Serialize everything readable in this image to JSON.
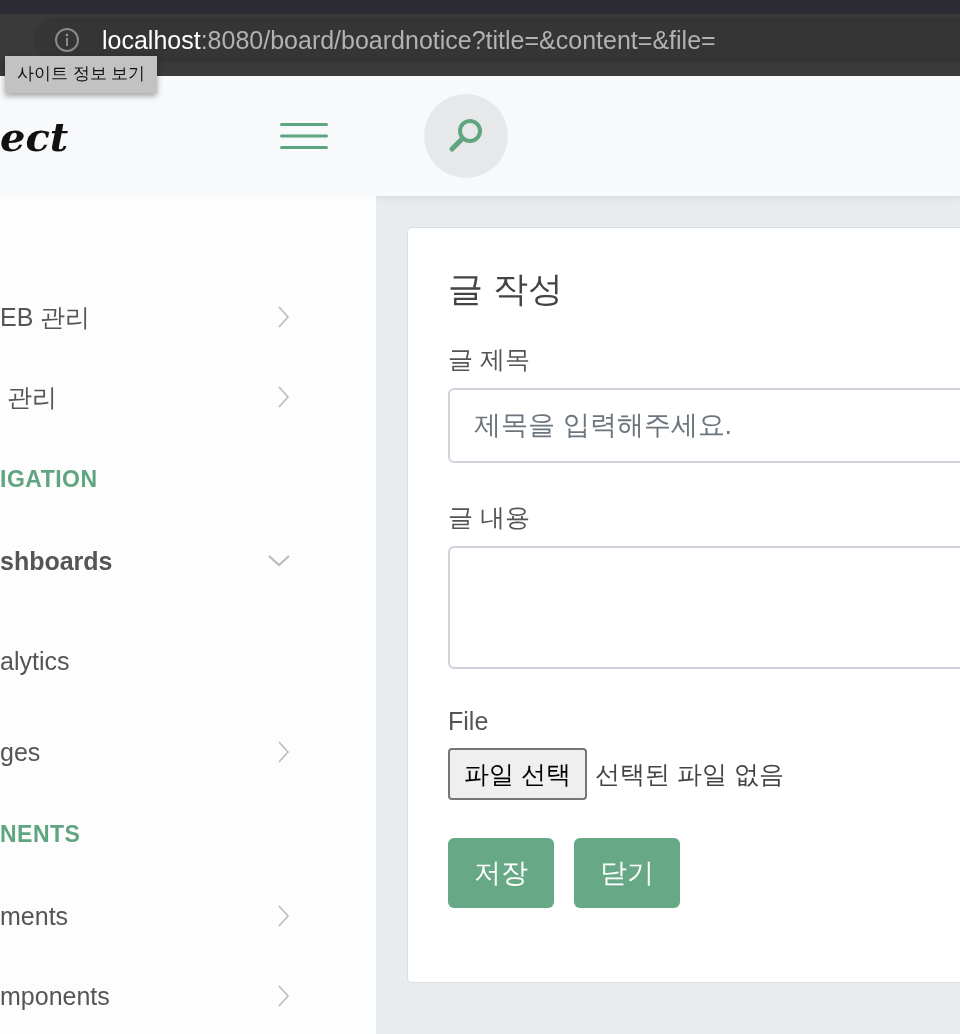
{
  "browser": {
    "url_host": "localhost",
    "url_rest": ":8080/board/boardnotice?title=&content=&file=",
    "tooltip": "사이트 정보 보기"
  },
  "sidebar": {
    "logo": "ect",
    "items": [
      {
        "kind": "item",
        "label": "EB 관리",
        "expanded": false
      },
      {
        "kind": "item",
        "label": " 관리",
        "expanded": false
      },
      {
        "kind": "heading",
        "label": "IGATION"
      },
      {
        "kind": "item",
        "label": "shboards",
        "expanded": true
      },
      {
        "kind": "subitem",
        "label": "alytics"
      },
      {
        "kind": "item",
        "label": "ges",
        "expanded": false
      },
      {
        "kind": "heading",
        "label": "NENTS"
      },
      {
        "kind": "item",
        "label": "ments",
        "expanded": false
      },
      {
        "kind": "item",
        "label": "mponents",
        "expanded": false
      }
    ]
  },
  "form": {
    "title": "글 작성",
    "fields": [
      {
        "kind": "text",
        "label": "글 제목",
        "placeholder": "제목을 입력해주세요."
      },
      {
        "kind": "textarea",
        "label": "글 내용"
      },
      {
        "kind": "file",
        "label": "File",
        "button": "파일 선택",
        "status": "선택된 파일 없음"
      }
    ],
    "buttons": [
      "저장",
      "닫기"
    ]
  }
}
